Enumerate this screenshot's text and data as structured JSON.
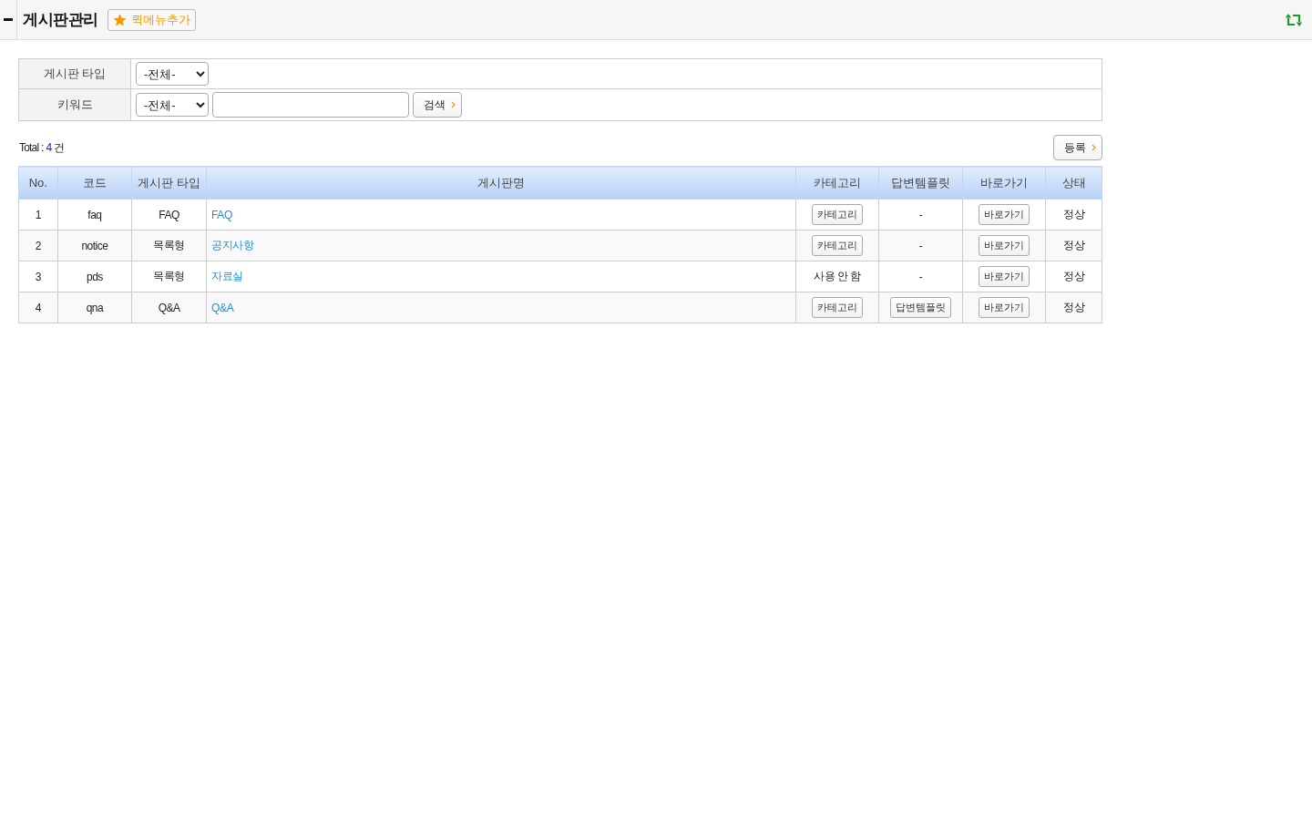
{
  "header": {
    "title": "게시판관리",
    "quick_menu_button": "퀵메뉴추가"
  },
  "filters": [
    {
      "kind": "select",
      "label": "게시판 타입",
      "select": "-전체-"
    },
    {
      "kind": "keyword",
      "label": "키워드",
      "select": "-전체-",
      "search_button": "검색"
    }
  ],
  "total": {
    "label": "Total :",
    "count": "4",
    "unit": "건"
  },
  "register_button": "등록",
  "table": {
    "columns": [
      "No.",
      "코드",
      "게시판 타입",
      "게시판명",
      "카테고리",
      "답변템플릿",
      "바로가기",
      "상태"
    ],
    "rows": [
      {
        "no": "1",
        "code": "faq",
        "type": "FAQ",
        "name": "FAQ",
        "category": {
          "kind": "button",
          "text": "카테고리"
        },
        "reply_template": {
          "kind": "text",
          "text": "-"
        },
        "shortcut": "바로가기",
        "status": "정상"
      },
      {
        "no": "2",
        "code": "notice",
        "type": "목록형",
        "name": "공지사항",
        "category": {
          "kind": "button",
          "text": "카테고리"
        },
        "reply_template": {
          "kind": "text",
          "text": "-"
        },
        "shortcut": "바로가기",
        "status": "정상"
      },
      {
        "no": "3",
        "code": "pds",
        "type": "목록형",
        "name": "자료실",
        "category": {
          "kind": "text",
          "text": "사용 안 함"
        },
        "reply_template": {
          "kind": "text",
          "text": "-"
        },
        "shortcut": "바로가기",
        "status": "정상"
      },
      {
        "no": "4",
        "code": "qna",
        "type": "Q&A",
        "name": "Q&A",
        "category": {
          "kind": "button",
          "text": "카테고리"
        },
        "reply_template": {
          "kind": "button",
          "text": "답변템플릿"
        },
        "shortcut": "바로가기",
        "status": "정상"
      }
    ]
  }
}
